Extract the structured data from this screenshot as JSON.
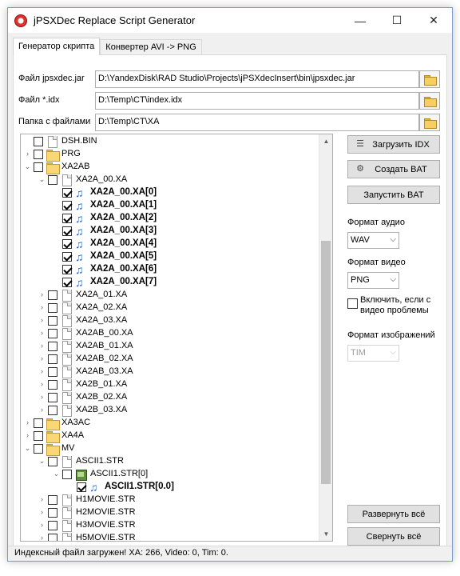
{
  "window": {
    "title": "jPSXDec Replace Script Generator",
    "minimize": "—",
    "maximize": "☐",
    "close": "✕"
  },
  "tabs": [
    {
      "label": "Генератор скрипта"
    },
    {
      "label": "Конвертер AVI -> PNG"
    }
  ],
  "fields": {
    "jar": {
      "label": "Файл jpsxdec.jar",
      "value": "D:\\YandexDisk\\RAD Studio\\Projects\\jPSXdecInsert\\bin\\jpsxdec.jar"
    },
    "idx": {
      "label": "Файл *.idx",
      "value": "D:\\Temp\\CT\\index.idx"
    },
    "folder": {
      "label": "Папка с файлами",
      "value": "D:\\Temp\\CT\\XA"
    }
  },
  "tree": [
    {
      "label": "DSH.BIN",
      "icon": "file",
      "expander": "",
      "checked": false,
      "bold": false
    },
    {
      "label": "PRG",
      "icon": "folder",
      "expander": "›",
      "checked": false,
      "bold": false
    },
    {
      "label": "XA2AB",
      "icon": "folder",
      "expander": "⌄",
      "checked": false,
      "bold": false
    },
    {
      "label": "XA2A_00.XA",
      "icon": "file",
      "expander": "⌄",
      "checked": false,
      "bold": false
    },
    {
      "label": "XA2A_00.XA[0]",
      "icon": "audio",
      "expander": "",
      "checked": true,
      "bold": true
    },
    {
      "label": "XA2A_00.XA[1]",
      "icon": "audio",
      "expander": "",
      "checked": true,
      "bold": true
    },
    {
      "label": "XA2A_00.XA[2]",
      "icon": "audio",
      "expander": "",
      "checked": true,
      "bold": true
    },
    {
      "label": "XA2A_00.XA[3]",
      "icon": "audio",
      "expander": "",
      "checked": true,
      "bold": true
    },
    {
      "label": "XA2A_00.XA[4]",
      "icon": "audio",
      "expander": "",
      "checked": true,
      "bold": true
    },
    {
      "label": "XA2A_00.XA[5]",
      "icon": "audio",
      "expander": "",
      "checked": true,
      "bold": true
    },
    {
      "label": "XA2A_00.XA[6]",
      "icon": "audio",
      "expander": "",
      "checked": true,
      "bold": true
    },
    {
      "label": "XA2A_00.XA[7]",
      "icon": "audio",
      "expander": "",
      "checked": true,
      "bold": true
    },
    {
      "label": "XA2A_01.XA",
      "icon": "file",
      "expander": "›",
      "checked": false,
      "bold": false
    },
    {
      "label": "XA2A_02.XA",
      "icon": "file",
      "expander": "›",
      "checked": false,
      "bold": false
    },
    {
      "label": "XA2A_03.XA",
      "icon": "file",
      "expander": "›",
      "checked": false,
      "bold": false
    },
    {
      "label": "XA2AB_00.XA",
      "icon": "file",
      "expander": "›",
      "checked": false,
      "bold": false
    },
    {
      "label": "XA2AB_01.XA",
      "icon": "file",
      "expander": "›",
      "checked": false,
      "bold": false
    },
    {
      "label": "XA2AB_02.XA",
      "icon": "file",
      "expander": "›",
      "checked": false,
      "bold": false
    },
    {
      "label": "XA2AB_03.XA",
      "icon": "file",
      "expander": "›",
      "checked": false,
      "bold": false
    },
    {
      "label": "XA2B_01.XA",
      "icon": "file",
      "expander": "›",
      "checked": false,
      "bold": false
    },
    {
      "label": "XA2B_02.XA",
      "icon": "file",
      "expander": "›",
      "checked": false,
      "bold": false
    },
    {
      "label": "XA2B_03.XA",
      "icon": "file",
      "expander": "›",
      "checked": false,
      "bold": false
    },
    {
      "label": "XA3AC",
      "icon": "folder",
      "expander": "›",
      "checked": false,
      "bold": false
    },
    {
      "label": "XA4A",
      "icon": "folder",
      "expander": "›",
      "checked": false,
      "bold": false
    },
    {
      "label": "MV",
      "icon": "folder",
      "expander": "⌄",
      "checked": false,
      "bold": false
    },
    {
      "label": "ASCII1.STR",
      "icon": "file",
      "expander": "⌄",
      "checked": false,
      "bold": false
    },
    {
      "label": "ASCII1.STR[0]",
      "icon": "video",
      "expander": "⌄",
      "checked": false,
      "bold": false
    },
    {
      "label": "ASCII1.STR[0.0]",
      "icon": "audio",
      "expander": "",
      "checked": true,
      "bold": true
    },
    {
      "label": "H1MOVIE.STR",
      "icon": "file",
      "expander": "›",
      "checked": false,
      "bold": false
    },
    {
      "label": "H2MOVIE.STR",
      "icon": "file",
      "expander": "›",
      "checked": false,
      "bold": false
    },
    {
      "label": "H3MOVIE.STR",
      "icon": "file",
      "expander": "›",
      "checked": false,
      "bold": false
    },
    {
      "label": "H5MOVIE.STR",
      "icon": "file",
      "expander": "›",
      "checked": false,
      "bold": false
    }
  ],
  "buttons": {
    "load_idx": "Загрузить IDX",
    "create_bat": "Создать BAT",
    "run_bat": "Запустить BAT",
    "expand_all": "Развернуть всё",
    "collapse_all": "Свернуть всё"
  },
  "audio_format": {
    "label": "Формат аудио",
    "value": "WAV"
  },
  "video_format": {
    "label": "Формат видео",
    "value": "PNG"
  },
  "video_problems": {
    "label": "Включить, если с видео проблемы",
    "checked": false
  },
  "image_format": {
    "label": "Формат изображений",
    "value": "TIM"
  },
  "status": "Индексный файл загружен! XA: 266, Video: 0, Tim: 0."
}
